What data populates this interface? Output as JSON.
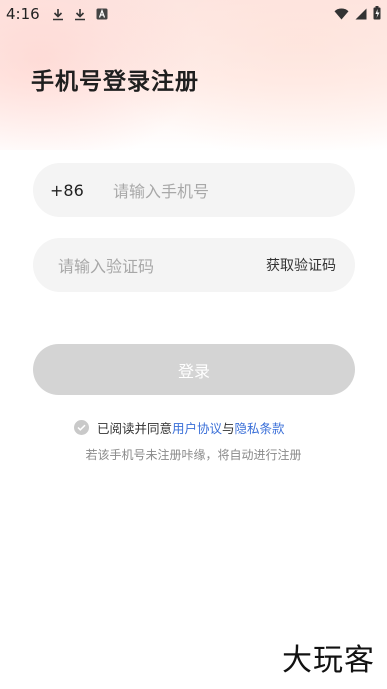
{
  "status_bar": {
    "time": "4:16",
    "icons_left": [
      "download-icon",
      "download-icon",
      "font-app-icon"
    ],
    "icons_right": [
      "wifi-icon",
      "signal-icon",
      "battery-charging-icon"
    ]
  },
  "header": {
    "title": "手机号登录注册"
  },
  "phone_field": {
    "country_code": "+86",
    "placeholder": "请输入手机号",
    "value": ""
  },
  "code_field": {
    "placeholder": "请输入验证码",
    "value": "",
    "get_code_label": "获取验证码"
  },
  "login": {
    "label": "登录",
    "enabled": false
  },
  "agreement": {
    "checked": true,
    "prefix": "已阅读并同意",
    "user_agreement": "用户协议",
    "conjunction": "与",
    "privacy_policy": "隐私条款",
    "link_color": "#3a6fd8"
  },
  "hint": "若该手机号未注册咔缘，将自动进行注册",
  "watermark": "大玩客",
  "colors": {
    "field_bg": "#f4f4f4",
    "button_disabled": "#d4d4d4",
    "header_gradient": "#fde6e2"
  }
}
